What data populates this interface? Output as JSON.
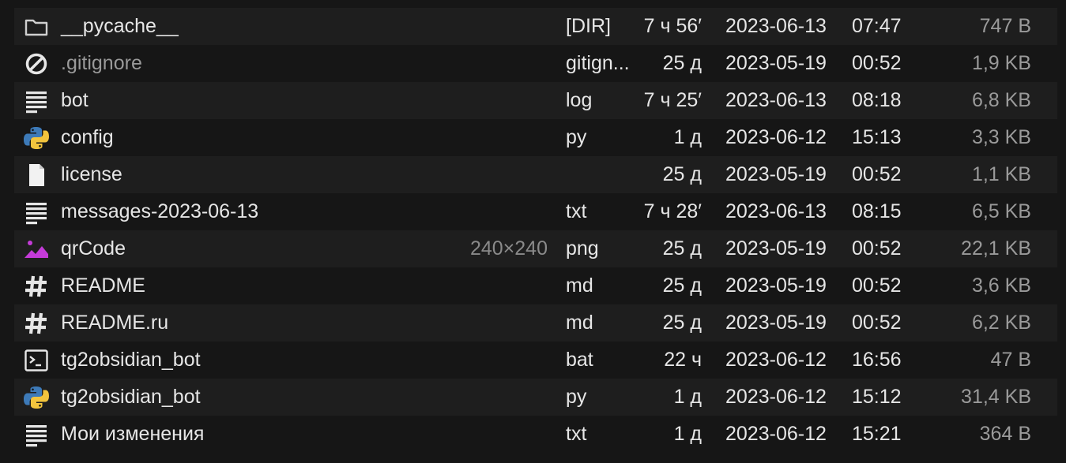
{
  "colors": {
    "background": "#161616",
    "row_alt": "#1e1e1e",
    "text": "#e6e6e6",
    "muted": "#9a9a9a",
    "python_blue": "#3d7ab8",
    "python_yellow": "#f2c43d",
    "image_magenta": "#c43bd8"
  },
  "files": [
    {
      "icon": "folder-icon",
      "name": "__pycache__",
      "dims": "",
      "ext": "[DIR]",
      "age": "7 ч 56′",
      "date": "2023-06-13",
      "time": "07:47",
      "size": "747 B"
    },
    {
      "icon": "ignore-icon",
      "name": ".gitignore",
      "dims": "",
      "ext": "gitign...",
      "age": "25 д",
      "date": "2023-05-19",
      "time": "00:52",
      "size": "1,9 KB",
      "dim": true
    },
    {
      "icon": "text-lines-icon",
      "name": "bot",
      "dims": "",
      "ext": "log",
      "age": "7 ч 25′",
      "date": "2023-06-13",
      "time": "08:18",
      "size": "6,8 KB"
    },
    {
      "icon": "python-icon",
      "name": "config",
      "dims": "",
      "ext": "py",
      "age": "1 д",
      "date": "2023-06-12",
      "time": "15:13",
      "size": "3,3 KB"
    },
    {
      "icon": "blank-file-icon",
      "name": "license",
      "dims": "",
      "ext": "",
      "age": "25 д",
      "date": "2023-05-19",
      "time": "00:52",
      "size": "1,1 KB"
    },
    {
      "icon": "text-lines-icon",
      "name": "messages-2023-06-13",
      "dims": "",
      "ext": "txt",
      "age": "7 ч 28′",
      "date": "2023-06-13",
      "time": "08:15",
      "size": "6,5 KB"
    },
    {
      "icon": "image-icon",
      "name": "qrCode",
      "dims": "240×240",
      "ext": "png",
      "age": "25 д",
      "date": "2023-05-19",
      "time": "00:52",
      "size": "22,1 KB"
    },
    {
      "icon": "hash-icon",
      "name": "README",
      "dims": "",
      "ext": "md",
      "age": "25 д",
      "date": "2023-05-19",
      "time": "00:52",
      "size": "3,6 KB"
    },
    {
      "icon": "hash-icon",
      "name": "README.ru",
      "dims": "",
      "ext": "md",
      "age": "25 д",
      "date": "2023-05-19",
      "time": "00:52",
      "size": "6,2 KB"
    },
    {
      "icon": "terminal-icon",
      "name": "tg2obsidian_bot",
      "dims": "",
      "ext": "bat",
      "age": "22 ч",
      "date": "2023-06-12",
      "time": "16:56",
      "size": "47 B"
    },
    {
      "icon": "python-icon",
      "name": "tg2obsidian_bot",
      "dims": "",
      "ext": "py",
      "age": "1 д",
      "date": "2023-06-12",
      "time": "15:12",
      "size": "31,4 KB"
    },
    {
      "icon": "text-lines-icon",
      "name": "Мои изменения",
      "dims": "",
      "ext": "txt",
      "age": "1 д",
      "date": "2023-06-12",
      "time": "15:21",
      "size": "364 B"
    }
  ]
}
